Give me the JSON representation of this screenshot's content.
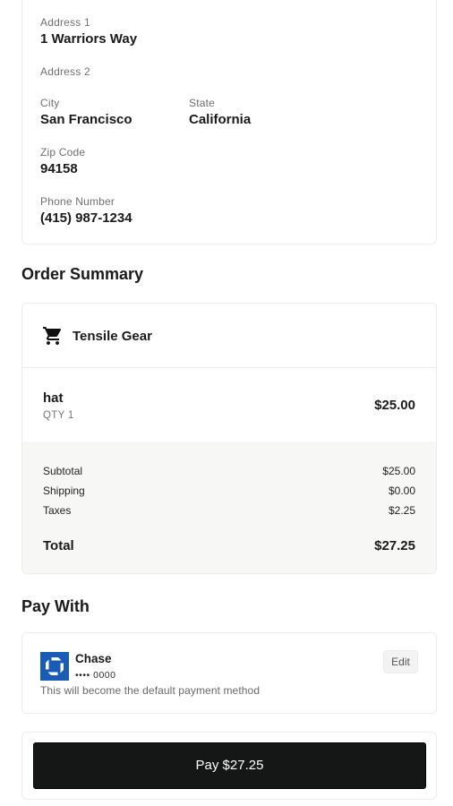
{
  "shipping_address": {
    "address1": {
      "label": "Address 1",
      "value": "1 Warriors Way"
    },
    "address2": {
      "label": "Address 2",
      "value": ""
    },
    "city": {
      "label": "City",
      "value": "San Francisco"
    },
    "state": {
      "label": "State",
      "value": "California"
    },
    "zip": {
      "label": "Zip Code",
      "value": "94158"
    },
    "phone": {
      "label": "Phone Number",
      "value": "(415) 987-1234"
    }
  },
  "order_summary": {
    "title": "Order Summary",
    "store_name": "Tensile Gear",
    "store_icon": "cart-icon",
    "items": [
      {
        "name": "hat",
        "qty": "QTY 1",
        "price": "$25.00"
      }
    ],
    "subtotal": {
      "label": "Subtotal",
      "value": "$25.00"
    },
    "shipping": {
      "label": "Shipping",
      "value": "$0.00"
    },
    "taxes": {
      "label": "Taxes",
      "value": "$2.25"
    },
    "total": {
      "label": "Total",
      "value": "$27.25"
    }
  },
  "pay_with": {
    "title": "Pay With",
    "bank_name": "Chase",
    "bank_icon": "chase-logo-icon",
    "card_number": "•••• 0000",
    "note": "This will become the default payment method",
    "edit_label": "Edit"
  },
  "pay_button": {
    "label": "Pay $27.25"
  },
  "colors": {
    "primary_button": "#151616",
    "bank_brand": "#1a5bb5",
    "totals_background": "#f7f7f6"
  }
}
